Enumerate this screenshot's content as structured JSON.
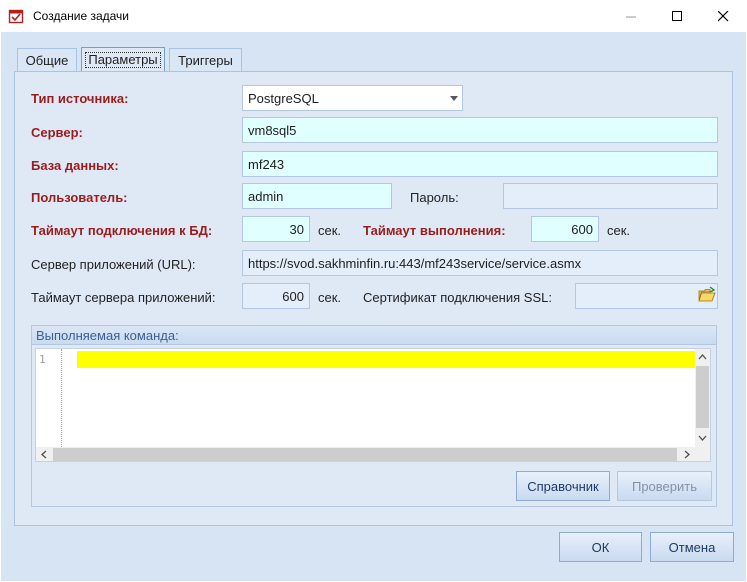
{
  "window": {
    "title": "Создание задачи",
    "minimize_glyph": "—",
    "maximize_glyph": "☐",
    "close_glyph": "✕",
    "icon": "task-icon"
  },
  "tabs": [
    {
      "label": "Общие",
      "active": false
    },
    {
      "label": "Параметры",
      "active": true
    },
    {
      "label": "Триггеры",
      "active": false
    }
  ],
  "form": {
    "source_type_label": "Тип источника:",
    "source_type_value": "PostgreSQL",
    "server_label": "Сервер:",
    "server_value": "vm8sql5",
    "database_label": "База данных:",
    "database_value": "mf243",
    "user_label": "Пользователь:",
    "user_value": "admin",
    "password_label": "Пароль:",
    "password_value": "",
    "db_timeout_label": "Таймаут подключения к БД:",
    "db_timeout_value": "30",
    "db_timeout_unit": "сек.",
    "exec_timeout_label": "Таймаут выполнения:",
    "exec_timeout_value": "600",
    "exec_timeout_unit": "сек.",
    "app_server_label": "Сервер приложений (URL):",
    "app_server_value": "https://svod.sakhminfin.ru:443/mf243service/service.asmx",
    "app_timeout_label": "Таймаут сервера приложений:",
    "app_timeout_value": "600",
    "app_timeout_unit": "сек.",
    "ssl_label": "Сертификат подключения SSL:",
    "ssl_value": ""
  },
  "command": {
    "title": "Выполняемая команда:",
    "line_number": "1",
    "text": ""
  },
  "buttons": {
    "reference": "Справочник",
    "check": "Проверить",
    "ok": "ОК",
    "cancel": "Отмена"
  },
  "colors": {
    "required_label": "#9b1c1c",
    "field_bg": "#e0ffff",
    "panel_bg": "#dfe9f6",
    "highlight_line": "#ffff00"
  }
}
